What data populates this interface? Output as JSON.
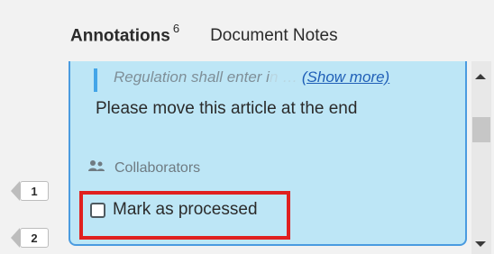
{
  "tabs": {
    "annotations_label": "Annotations",
    "annotations_count": "6",
    "document_notes_label": "Document Notes"
  },
  "annotation": {
    "quote_text": "Regulation shall enter i",
    "quote_faded": "n",
    "quote_ellipsis": "…",
    "show_more": "(Show more)",
    "comment": "Please move this article at the end",
    "collaborators_label": "Collaborators",
    "collaborators_icon": "people-icon",
    "mark_processed_label": "Mark as processed",
    "mark_processed_checked": false
  },
  "margin_badges": [
    "1",
    "2"
  ],
  "colors": {
    "card_background": "#bde6f6",
    "card_border": "#4a9be0",
    "highlight_border": "#e0201f",
    "link": "#1f5fb7"
  }
}
